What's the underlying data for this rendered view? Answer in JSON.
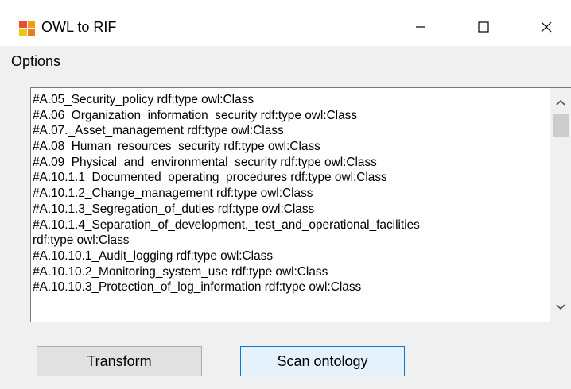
{
  "window": {
    "title": "OWL to RIF",
    "icons": {
      "app": "app-window-icon",
      "minimize": "minimize-icon",
      "maximize": "maximize-icon",
      "close": "close-icon"
    }
  },
  "menu": {
    "items": [
      {
        "label": "Options"
      }
    ]
  },
  "output": {
    "lines": [
      "#A.05_Security_policy rdf:type owl:Class",
      "#A.06_Organization_information_security rdf:type owl:Class",
      "#A.07._Asset_management rdf:type owl:Class",
      "#A.08_Human_resources_security rdf:type owl:Class",
      "#A.09_Physical_and_environmental_security rdf:type owl:Class",
      "#A.10.1.1_Documented_operating_procedures rdf:type owl:Class",
      "#A.10.1.2_Change_management rdf:type owl:Class",
      "#A.10.1.3_Segregation_of_duties rdf:type owl:Class",
      "#A.10.1.4_Separation_of_development,_test_and_operational_facilities",
      "rdf:type owl:Class",
      "#A.10.10.1_Audit_logging rdf:type owl:Class",
      "#A.10.10.2_Monitoring_system_use rdf:type owl:Class",
      "#A.10.10.3_Protection_of_log_information rdf:type owl:Class"
    ],
    "scroll_icons": {
      "up": "chevron-up-icon",
      "down": "chevron-down-icon"
    }
  },
  "buttons": {
    "transform": "Transform",
    "scan": "Scan ontology"
  },
  "colors": {
    "window_bg": "#f0f0f0",
    "titlebar_bg": "#ffffff",
    "focus_border": "#0078d7"
  }
}
